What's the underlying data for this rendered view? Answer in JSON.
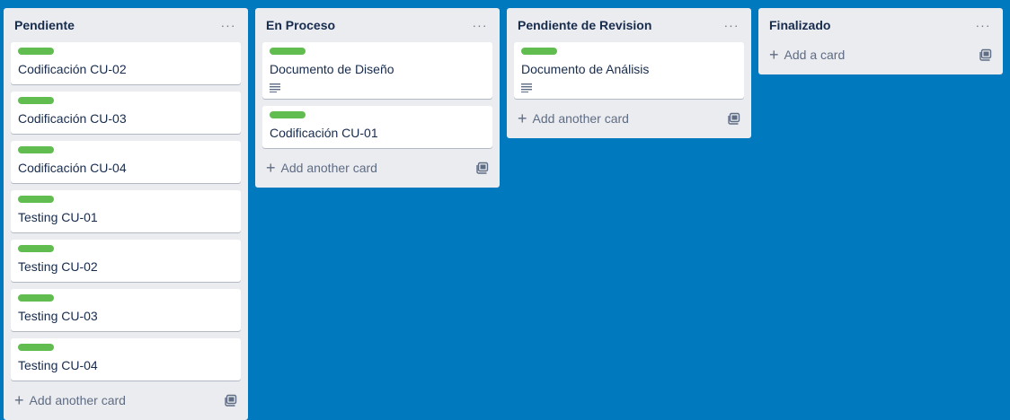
{
  "colors": {
    "board_bg": "#0079bf",
    "list_bg": "#ebecf0",
    "label_green": "#61bd4f"
  },
  "lists": [
    {
      "title": "Pendiente",
      "cards": [
        {
          "title": "Codificación CU-02",
          "label": "green"
        },
        {
          "title": "Codificación CU-03",
          "label": "green"
        },
        {
          "title": "Codificación CU-04",
          "label": "green"
        },
        {
          "title": "Testing CU-01",
          "label": "green"
        },
        {
          "title": "Testing CU-02",
          "label": "green"
        },
        {
          "title": "Testing CU-03",
          "label": "green"
        },
        {
          "title": "Testing CU-04",
          "label": "green"
        }
      ],
      "add_label": "Add another card"
    },
    {
      "title": "En Proceso",
      "cards": [
        {
          "title": "Documento de Diseño",
          "label": "green",
          "has_description": true
        },
        {
          "title": "Codificación CU-01",
          "label": "green"
        }
      ],
      "add_label": "Add another card"
    },
    {
      "title": "Pendiente de Revision",
      "cards": [
        {
          "title": "Documento de Análisis",
          "label": "green",
          "has_description": true
        }
      ],
      "add_label": "Add another card"
    },
    {
      "title": "Finalizado",
      "cards": [],
      "add_label": "Add a card"
    }
  ],
  "icons": {
    "menu": "more-horizontal-icon",
    "description": "description-icon",
    "add": "plus-icon",
    "template": "card-template-icon"
  }
}
